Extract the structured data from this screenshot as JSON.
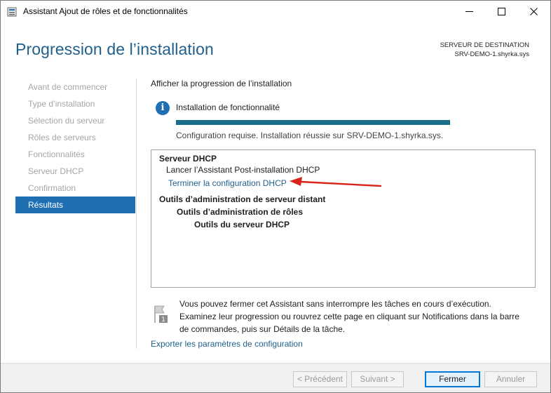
{
  "window": {
    "title": "Assistant Ajout de rôles et de fonctionnalités",
    "controls": {
      "minimize": "—",
      "maximize": "☐",
      "close": "✕"
    }
  },
  "header": {
    "title": "Progression de l’installation",
    "destination_label": "SERVEUR DE DESTINATION",
    "destination_server": "SRV-DEMO-1.shyrka.sys"
  },
  "nav": {
    "items": [
      {
        "label": "Avant de commencer",
        "active": false
      },
      {
        "label": "Type d’installation",
        "active": false
      },
      {
        "label": "Sélection du serveur",
        "active": false
      },
      {
        "label": "Rôles de serveurs",
        "active": false
      },
      {
        "label": "Fonctionnalités",
        "active": false
      },
      {
        "label": "Serveur DHCP",
        "active": false
      },
      {
        "label": "Confirmation",
        "active": false
      },
      {
        "label": "Résultats",
        "active": true
      }
    ]
  },
  "main": {
    "section_title": "Afficher la progression de l’installation",
    "install_label": "Installation de fonctionnalité",
    "progress": 1.0,
    "status": "Configuration requise. Installation réussie sur SRV-DEMO-1.shyrka.sys.",
    "results": {
      "dhcp_server": "Serveur DHCP",
      "launch_wizard": "Lancer l’Assistant Post-installation DHCP",
      "finish_config_link": "Terminer la configuration DHCP",
      "remote_tools": "Outils d’administration de serveur distant",
      "role_tools": "Outils d’administration de rôles",
      "dhcp_tools": "Outils du serveur DHCP"
    },
    "note": "Vous pouvez fermer cet Assistant sans interrompre les tâches en cours d’exécution. Examinez leur progression ou rouvrez cette page en cliquant sur Notifications dans la barre de commandes, puis sur Détails de la tâche.",
    "note_badge": "1",
    "export_link": "Exporter les paramètres de configuration"
  },
  "footer": {
    "previous": "< Précédent",
    "next": "Suivant >",
    "close": "Fermer",
    "cancel": "Annuler"
  },
  "colors": {
    "accent": "#1f6fb5",
    "title": "#1f5f8b",
    "progress": "#1b6e87",
    "arrow": "#d9241b"
  }
}
